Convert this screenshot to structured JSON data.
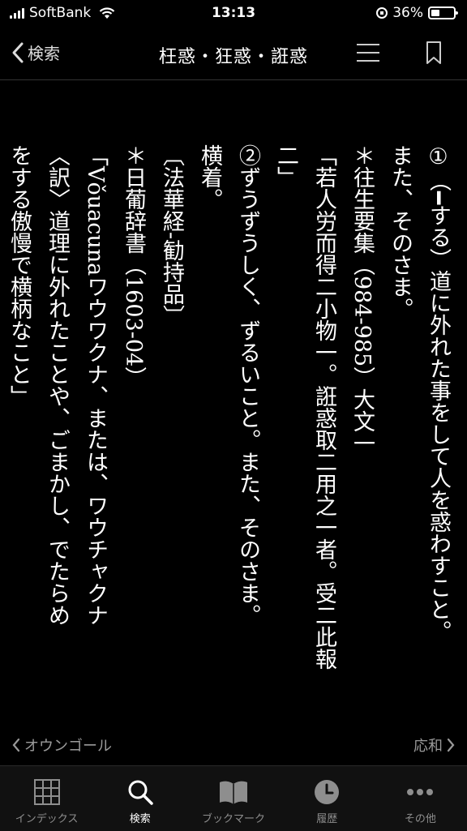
{
  "status": {
    "carrier": "SoftBank",
    "time": "13:13",
    "battery": "36%"
  },
  "nav": {
    "back_label": "検索",
    "title": "枉惑・狂惑・誑惑"
  },
  "content": {
    "columns": [
      "①（━する）道に外れた事をして人を惑わすこと。",
      "また、そのさま。",
      "＊往生要集（984‐985）大文一",
      "「若人労而得二小物一。誑惑取二用之一者。受二此報",
      "二」",
      "②ずうずうしく、ずるいこと。また、そのさま。",
      "横着。",
      "〔法華経‐勧持品〕",
      "＊日葡辞書（1603‐04）",
      "「Vǒuacunaワウワクナ、または、ワウチャクナ",
      "〈訳〉道理に外れたことや、ごまかし、でたらめ",
      "をする傲慢で横柄なこと」"
    ]
  },
  "prev_next": {
    "prev": "オウンゴール",
    "next": "応和"
  },
  "tabs": [
    {
      "label": "インデックス",
      "icon": "grid-icon"
    },
    {
      "label": "検索",
      "icon": "search-icon"
    },
    {
      "label": "ブックマーク",
      "icon": "book-icon"
    },
    {
      "label": "履歴",
      "icon": "clock-icon"
    },
    {
      "label": "その他",
      "icon": "more-icon"
    }
  ]
}
